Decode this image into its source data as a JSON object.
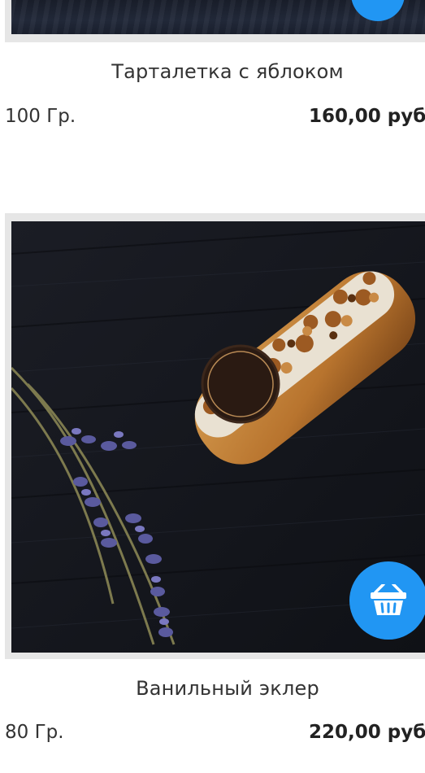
{
  "products": [
    {
      "title": "Тарталетка с яблоком",
      "weight": "100 Гр.",
      "price": "160,00 руб"
    },
    {
      "title": "Ванильный эклер",
      "weight": "80 Гр.",
      "price": "220,00 руб",
      "image_icon": "eclair-photo",
      "cart_icon": "basket-icon"
    }
  ],
  "colors": {
    "accent": "#2196f3",
    "frame": "#e6e6e6",
    "photo_bg": "#14161d"
  }
}
